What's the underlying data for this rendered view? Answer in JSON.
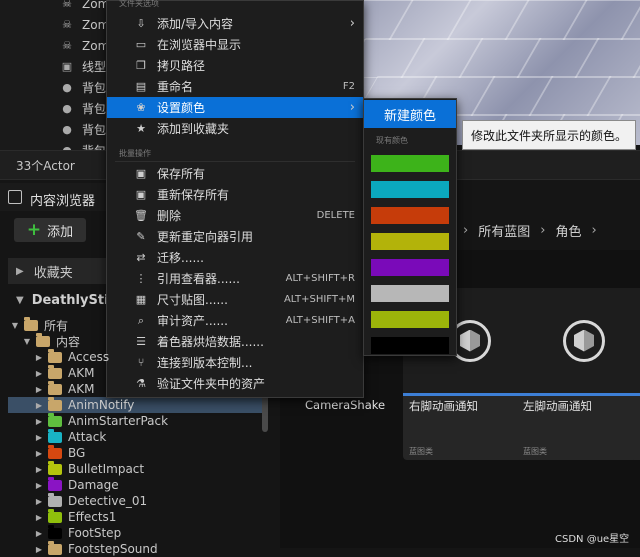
{
  "outliner": {
    "rows": [
      {
        "icon": "skull-icon",
        "label": "Zom"
      },
      {
        "icon": "skull-icon",
        "label": "Zom"
      },
      {
        "icon": "skull-icon",
        "label": "Zom"
      },
      {
        "icon": "cube-icon",
        "label": "线型"
      },
      {
        "icon": "backpack-icon",
        "label": "背包"
      },
      {
        "icon": "backpack-icon",
        "label": "背包"
      },
      {
        "icon": "backpack-icon",
        "label": "背包"
      },
      {
        "icon": "backpack-icon",
        "label": "背包"
      }
    ],
    "actor_count": "33个Actor"
  },
  "content_browser": {
    "title": "内容浏览器",
    "add_label": "添加",
    "favorites_label": "收藏夹",
    "project_label": "DeathlyStillne",
    "tree": [
      {
        "label": "所有",
        "color": "#c8a66a",
        "level": 0,
        "expanded": true
      },
      {
        "label": "内容",
        "color": "#c8a66a",
        "level": 1,
        "expanded": true
      },
      {
        "label": "Access",
        "color": "#c8a66a",
        "level": 2
      },
      {
        "label": "AKM",
        "color": "#c8a66a",
        "level": 2
      },
      {
        "label": "AKM",
        "color": "#c8a66a",
        "level": 2
      },
      {
        "label": "AnimNotify",
        "color": "#c8a66a",
        "level": 2,
        "selected": true
      },
      {
        "label": "AnimStarterPack",
        "color": "#5fbf3f",
        "level": 2
      },
      {
        "label": "Attack",
        "color": "#19b3c4",
        "level": 2
      },
      {
        "label": "BG",
        "color": "#d64810",
        "level": 2
      },
      {
        "label": "BulletImpact",
        "color": "#b4c40d",
        "level": 2
      },
      {
        "label": "Damage",
        "color": "#8a14c4",
        "level": 2
      },
      {
        "label": "Detective_01",
        "color": "#b0b0b0",
        "level": 2
      },
      {
        "label": "Effects1",
        "color": "#8fbf0c",
        "level": 2
      },
      {
        "label": "FootStep",
        "color": "#000000",
        "level": 2
      },
      {
        "label": "FootstepSound",
        "color": "#c8a66a",
        "level": 2
      }
    ],
    "breadcrumb": [
      "容",
      "所有蓝图",
      "角色"
    ],
    "assets": [
      {
        "name": "右脚动画通知",
        "type": "蓝图类"
      },
      {
        "name": "左脚动画通知",
        "type": "蓝图类"
      },
      {
        "name": "",
        "type": ""
      }
    ],
    "camera_label": "CameraShake"
  },
  "menu": {
    "section_top": "文件夹选项",
    "items_top": [
      {
        "icon": "import-icon",
        "label": "添加/导入内容",
        "submenu": true
      },
      {
        "icon": "folder-open-icon",
        "label": "在浏览器中显示"
      },
      {
        "icon": "copy-icon",
        "label": "拷贝路径"
      },
      {
        "icon": "rename-icon",
        "label": "重命名",
        "shortcut": "F2"
      },
      {
        "icon": "palette-icon",
        "label": "设置颜色",
        "submenu": true,
        "highlighted": true
      },
      {
        "icon": "star-icon",
        "label": "添加到收藏夹"
      }
    ],
    "section_bulk": "批量操作",
    "items_bulk": [
      {
        "icon": "save-icon",
        "label": "保存所有"
      },
      {
        "icon": "resave-icon",
        "label": "重新保存所有"
      },
      {
        "icon": "trash-icon",
        "label": "删除",
        "shortcut": "DELETE"
      },
      {
        "icon": "wrench-icon",
        "label": "更新重定向器引用"
      },
      {
        "icon": "migrate-icon",
        "label": "迁移......"
      },
      {
        "icon": "reference-icon",
        "label": "引用查看器......",
        "shortcut": "ALT+SHIFT+R"
      },
      {
        "icon": "size-map-icon",
        "label": "尺寸贴图......",
        "shortcut": "ALT+SHIFT+M"
      },
      {
        "icon": "audit-icon",
        "label": "审计资产......",
        "shortcut": "ALT+SHIFT+A"
      },
      {
        "icon": "shader-icon",
        "label": "着色器烘焙数据......"
      },
      {
        "icon": "source-control-icon",
        "label": "连接到版本控制..."
      },
      {
        "icon": "flask-icon",
        "label": "验证文件夹中的资产"
      }
    ]
  },
  "color_submenu": {
    "new_color": "新建颜色",
    "existing_label": "现有颜色",
    "swatches": [
      "#3db31a",
      "#0ba8be",
      "#c63c0a",
      "#b3b30a",
      "#7a0ab9",
      "#b7b7b7",
      "#9cb40a",
      "#000000"
    ]
  },
  "tooltip": "修改此文件夹所显示的颜色。",
  "watermark": "CSDN @ue星空"
}
